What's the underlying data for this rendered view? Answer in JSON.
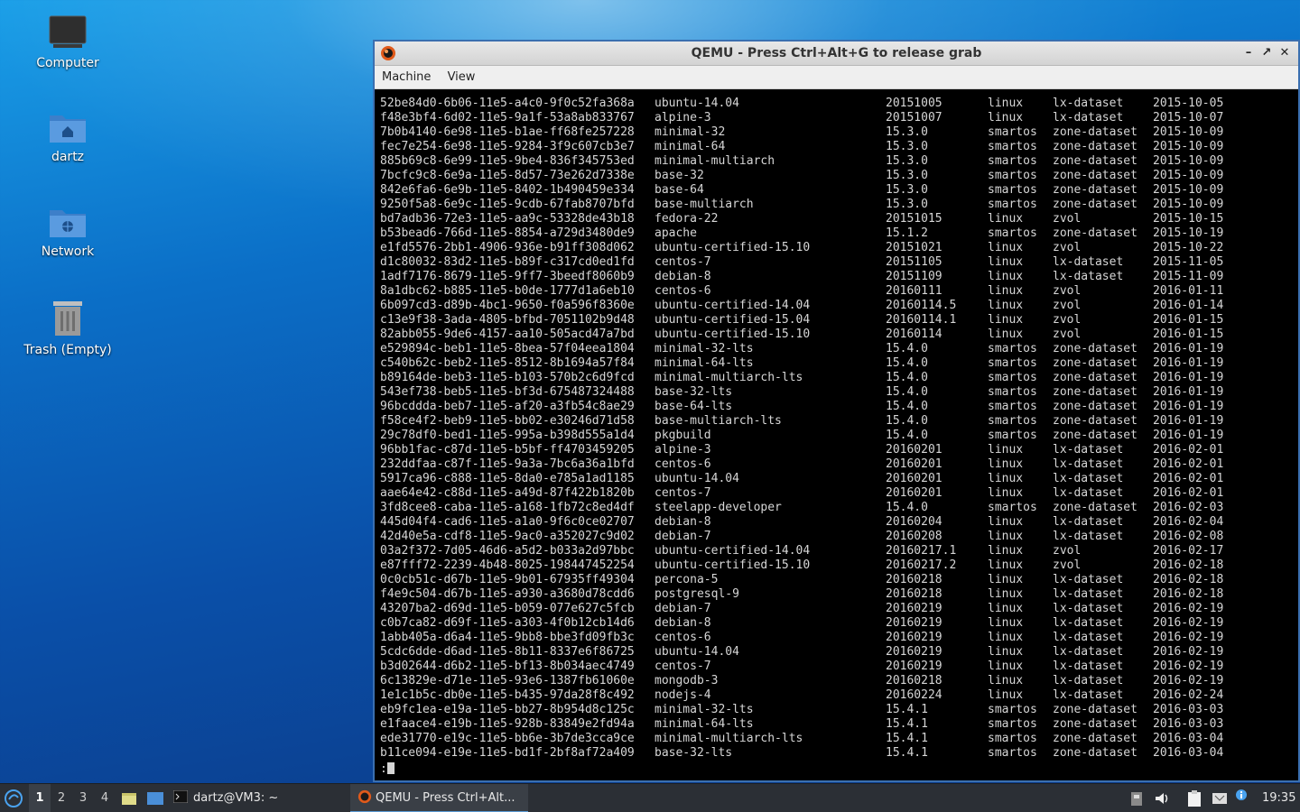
{
  "desktop": {
    "icons": [
      {
        "label": "Computer",
        "icon": "computer-icon"
      },
      {
        "label": "dartz",
        "icon": "home-folder-icon"
      },
      {
        "label": "Network",
        "icon": "network-folder-icon"
      },
      {
        "label": "Trash (Empty)",
        "icon": "trash-icon"
      }
    ]
  },
  "window": {
    "title": "QEMU - Press Ctrl+Alt+G to release grab",
    "menu": [
      "Machine",
      "View"
    ],
    "rows": [
      [
        "52be84d0-6b06-11e5-a4c0-9f0c52fa368a",
        "ubuntu-14.04",
        "20151005",
        "linux",
        "lx-dataset",
        "2015-10-05"
      ],
      [
        "f48e3bf4-6d02-11e5-9a1f-53a8ab833767",
        "alpine-3",
        "20151007",
        "linux",
        "lx-dataset",
        "2015-10-07"
      ],
      [
        "7b0b4140-6e98-11e5-b1ae-ff68fe257228",
        "minimal-32",
        "15.3.0",
        "smartos",
        "zone-dataset",
        "2015-10-09"
      ],
      [
        "fec7e254-6e98-11e5-9284-3f9c607cb3e7",
        "minimal-64",
        "15.3.0",
        "smartos",
        "zone-dataset",
        "2015-10-09"
      ],
      [
        "885b69c8-6e99-11e5-9be4-836f345753ed",
        "minimal-multiarch",
        "15.3.0",
        "smartos",
        "zone-dataset",
        "2015-10-09"
      ],
      [
        "7bcfc9c8-6e9a-11e5-8d57-73e262d7338e",
        "base-32",
        "15.3.0",
        "smartos",
        "zone-dataset",
        "2015-10-09"
      ],
      [
        "842e6fa6-6e9b-11e5-8402-1b490459e334",
        "base-64",
        "15.3.0",
        "smartos",
        "zone-dataset",
        "2015-10-09"
      ],
      [
        "9250f5a8-6e9c-11e5-9cdb-67fab8707bfd",
        "base-multiarch",
        "15.3.0",
        "smartos",
        "zone-dataset",
        "2015-10-09"
      ],
      [
        "bd7adb36-72e3-11e5-aa9c-53328de43b18",
        "fedora-22",
        "20151015",
        "linux",
        "zvol",
        "2015-10-15"
      ],
      [
        "b53bead6-766d-11e5-8854-a729d3480de9",
        "apache",
        "15.1.2",
        "smartos",
        "zone-dataset",
        "2015-10-19"
      ],
      [
        "e1fd5576-2bb1-4906-936e-b91ff308d062",
        "ubuntu-certified-15.10",
        "20151021",
        "linux",
        "zvol",
        "2015-10-22"
      ],
      [
        "d1c80032-83d2-11e5-b89f-c317cd0ed1fd",
        "centos-7",
        "20151105",
        "linux",
        "lx-dataset",
        "2015-11-05"
      ],
      [
        "1adf7176-8679-11e5-9ff7-3beedf8060b9",
        "debian-8",
        "20151109",
        "linux",
        "lx-dataset",
        "2015-11-09"
      ],
      [
        "8a1dbc62-b885-11e5-b0de-1777d1a6eb10",
        "centos-6",
        "20160111",
        "linux",
        "zvol",
        "2016-01-11"
      ],
      [
        "6b097cd3-d89b-4bc1-9650-f0a596f8360e",
        "ubuntu-certified-14.04",
        "20160114.5",
        "linux",
        "zvol",
        "2016-01-14"
      ],
      [
        "c13e9f38-3ada-4805-bfbd-7051102b9d48",
        "ubuntu-certified-15.04",
        "20160114.1",
        "linux",
        "zvol",
        "2016-01-15"
      ],
      [
        "82abb055-9de6-4157-aa10-505acd47a7bd",
        "ubuntu-certified-15.10",
        "20160114",
        "linux",
        "zvol",
        "2016-01-15"
      ],
      [
        "e529894c-beb1-11e5-8bea-57f04eea1804",
        "minimal-32-lts",
        "15.4.0",
        "smartos",
        "zone-dataset",
        "2016-01-19"
      ],
      [
        "c540b62c-beb2-11e5-8512-8b1694a57f84",
        "minimal-64-lts",
        "15.4.0",
        "smartos",
        "zone-dataset",
        "2016-01-19"
      ],
      [
        "b89164de-beb3-11e5-b103-570b2c6d9fcd",
        "minimal-multiarch-lts",
        "15.4.0",
        "smartos",
        "zone-dataset",
        "2016-01-19"
      ],
      [
        "543ef738-beb5-11e5-bf3d-675487324488",
        "base-32-lts",
        "15.4.0",
        "smartos",
        "zone-dataset",
        "2016-01-19"
      ],
      [
        "96bcddda-beb7-11e5-af20-a3fb54c8ae29",
        "base-64-lts",
        "15.4.0",
        "smartos",
        "zone-dataset",
        "2016-01-19"
      ],
      [
        "f58ce4f2-beb9-11e5-bb02-e30246d71d58",
        "base-multiarch-lts",
        "15.4.0",
        "smartos",
        "zone-dataset",
        "2016-01-19"
      ],
      [
        "29c78df0-bed1-11e5-995a-b398d555a1d4",
        "pkgbuild",
        "15.4.0",
        "smartos",
        "zone-dataset",
        "2016-01-19"
      ],
      [
        "96bb1fac-c87d-11e5-b5bf-ff4703459205",
        "alpine-3",
        "20160201",
        "linux",
        "lx-dataset",
        "2016-02-01"
      ],
      [
        "232ddfaa-c87f-11e5-9a3a-7bc6a36a1bfd",
        "centos-6",
        "20160201",
        "linux",
        "lx-dataset",
        "2016-02-01"
      ],
      [
        "5917ca96-c888-11e5-8da0-e785a1ad1185",
        "ubuntu-14.04",
        "20160201",
        "linux",
        "lx-dataset",
        "2016-02-01"
      ],
      [
        "aae64e42-c88d-11e5-a49d-87f422b1820b",
        "centos-7",
        "20160201",
        "linux",
        "lx-dataset",
        "2016-02-01"
      ],
      [
        "3fd8cee8-caba-11e5-a168-1fb72c8ed4df",
        "steelapp-developer",
        "15.4.0",
        "smartos",
        "zone-dataset",
        "2016-02-03"
      ],
      [
        "445d04f4-cad6-11e5-a1a0-9f6c0ce02707",
        "debian-8",
        "20160204",
        "linux",
        "lx-dataset",
        "2016-02-04"
      ],
      [
        "42d40e5a-cdf8-11e5-9ac0-a352027c9d02",
        "debian-7",
        "20160208",
        "linux",
        "lx-dataset",
        "2016-02-08"
      ],
      [
        "03a2f372-7d05-46d6-a5d2-b033a2d97bbc",
        "ubuntu-certified-14.04",
        "20160217.1",
        "linux",
        "zvol",
        "2016-02-17"
      ],
      [
        "e87fff72-2239-4b48-8025-198447452254",
        "ubuntu-certified-15.10",
        "20160217.2",
        "linux",
        "zvol",
        "2016-02-18"
      ],
      [
        "0c0cb51c-d67b-11e5-9b01-67935ff49304",
        "percona-5",
        "20160218",
        "linux",
        "lx-dataset",
        "2016-02-18"
      ],
      [
        "f4e9c504-d67b-11e5-a930-a3680d78cdd6",
        "postgresql-9",
        "20160218",
        "linux",
        "lx-dataset",
        "2016-02-18"
      ],
      [
        "43207ba2-d69d-11e5-b059-077e627c5fcb",
        "debian-7",
        "20160219",
        "linux",
        "lx-dataset",
        "2016-02-19"
      ],
      [
        "c0b7ca82-d69f-11e5-a303-4f0b12cb14d6",
        "debian-8",
        "20160219",
        "linux",
        "lx-dataset",
        "2016-02-19"
      ],
      [
        "1abb405a-d6a4-11e5-9bb8-bbe3fd09fb3c",
        "centos-6",
        "20160219",
        "linux",
        "lx-dataset",
        "2016-02-19"
      ],
      [
        "5cdc6dde-d6ad-11e5-8b11-8337e6f86725",
        "ubuntu-14.04",
        "20160219",
        "linux",
        "lx-dataset",
        "2016-02-19"
      ],
      [
        "b3d02644-d6b2-11e5-bf13-8b034aec4749",
        "centos-7",
        "20160219",
        "linux",
        "lx-dataset",
        "2016-02-19"
      ],
      [
        "6c13829e-d71e-11e5-93e6-1387fb61060e",
        "mongodb-3",
        "20160218",
        "linux",
        "lx-dataset",
        "2016-02-19"
      ],
      [
        "1e1c1b5c-db0e-11e5-b435-97da28f8c492",
        "nodejs-4",
        "20160224",
        "linux",
        "lx-dataset",
        "2016-02-24"
      ],
      [
        "eb9fc1ea-e19a-11e5-bb27-8b954d8c125c",
        "minimal-32-lts",
        "15.4.1",
        "smartos",
        "zone-dataset",
        "2016-03-03"
      ],
      [
        "e1faace4-e19b-11e5-928b-83849e2fd94a",
        "minimal-64-lts",
        "15.4.1",
        "smartos",
        "zone-dataset",
        "2016-03-03"
      ],
      [
        "ede31770-e19c-11e5-bb6e-3b7de3cca9ce",
        "minimal-multiarch-lts",
        "15.4.1",
        "smartos",
        "zone-dataset",
        "2016-03-04"
      ],
      [
        "b11ce094-e19e-11e5-bd1f-2bf8af72a409",
        "base-32-lts",
        "15.4.1",
        "smartos",
        "zone-dataset",
        "2016-03-04"
      ]
    ],
    "prompt": ":"
  },
  "taskbar": {
    "workspaces": [
      "1",
      "2",
      "3",
      "4"
    ],
    "terminal_task": "dartz@VM3: ~",
    "qemu_task": "QEMU - Press Ctrl+Alt...",
    "clock": "19:35"
  }
}
